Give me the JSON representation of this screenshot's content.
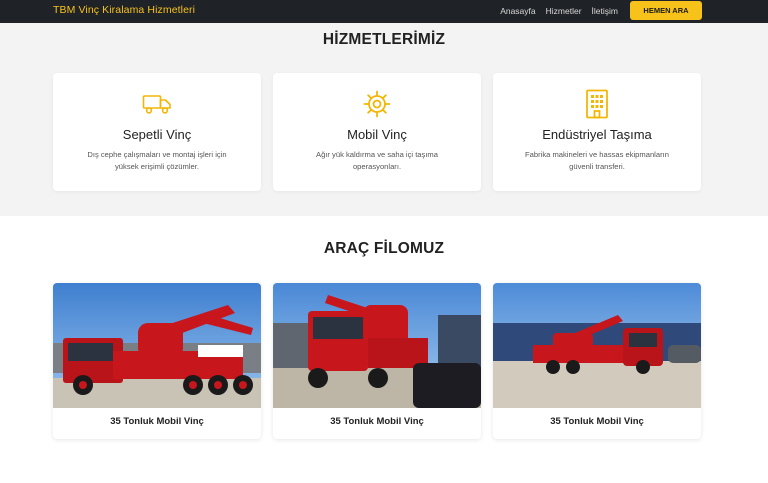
{
  "header": {
    "brand": "TBM Vinç Kiralama Hizmetleri",
    "links": [
      "Anasayfa",
      "Hizmetler",
      "İletişim"
    ],
    "cta_label": "HEMEN ARA"
  },
  "services": {
    "title": "HİZMETLERİMİZ",
    "items": [
      {
        "title": "Sepetli Vinç",
        "desc": "Dış cephe çalışmaları ve montaj işleri için yüksek erişimli çözümler.",
        "icon": "truck-icon"
      },
      {
        "title": "Mobil Vinç",
        "desc": "Ağır yük kaldırma ve saha içi taşıma operasyonları.",
        "icon": "gear-icon"
      },
      {
        "title": "Endüstriyel Taşıma",
        "desc": "Fabrika makineleri ve hassas ekipmanların güvenli transferi.",
        "icon": "building-icon"
      }
    ]
  },
  "fleet": {
    "title": "ARAÇ FİLOMUZ",
    "items": [
      {
        "label": "35 Tonluk Mobil Vinç"
      },
      {
        "label": "35 Tonluk Mobil Vinç"
      },
      {
        "label": "35 Tonluk Mobil Vinç"
      }
    ]
  },
  "colors": {
    "accent": "#f7c21a",
    "nav_bg": "#1f2226",
    "truck_red": "#c8161d"
  }
}
